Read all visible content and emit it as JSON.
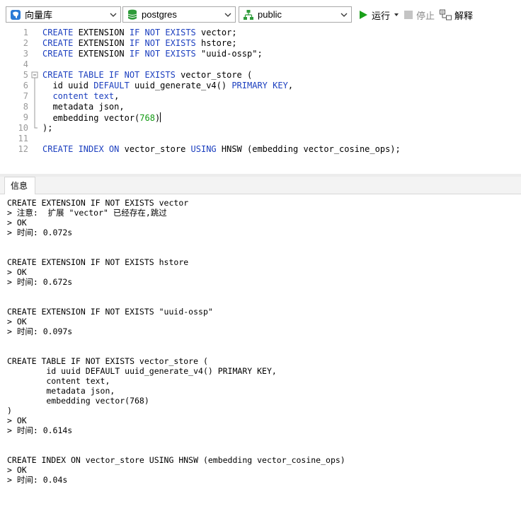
{
  "toolbar": {
    "connection": "向量库",
    "database": "postgres",
    "schema": "public",
    "run_label": "运行",
    "stop_label": "停止",
    "explain_label": "解释"
  },
  "editor": {
    "lines": [
      {
        "n": "1",
        "tokens": [
          {
            "t": "kw",
            "v": "CREATE"
          },
          {
            "t": "id",
            "v": " EXTENSION "
          },
          {
            "t": "kw",
            "v": "IF NOT EXISTS"
          },
          {
            "t": "id",
            "v": " vector;"
          }
        ]
      },
      {
        "n": "2",
        "tokens": [
          {
            "t": "kw",
            "v": "CREATE"
          },
          {
            "t": "id",
            "v": " EXTENSION "
          },
          {
            "t": "kw",
            "v": "IF NOT EXISTS"
          },
          {
            "t": "id",
            "v": " hstore;"
          }
        ]
      },
      {
        "n": "3",
        "tokens": [
          {
            "t": "kw",
            "v": "CREATE"
          },
          {
            "t": "id",
            "v": " EXTENSION "
          },
          {
            "t": "kw",
            "v": "IF NOT EXISTS"
          },
          {
            "t": "str",
            "v": " \"uuid-ossp\";"
          }
        ]
      },
      {
        "n": "4",
        "tokens": []
      },
      {
        "n": "5",
        "tokens": [
          {
            "t": "kw",
            "v": "CREATE TABLE IF NOT EXISTS"
          },
          {
            "t": "id",
            "v": " vector_store ("
          }
        ]
      },
      {
        "n": "6",
        "tokens": [
          {
            "t": "id",
            "v": "  id uuid "
          },
          {
            "t": "kw",
            "v": "DEFAULT"
          },
          {
            "t": "id",
            "v": " uuid_generate_v4() "
          },
          {
            "t": "kw",
            "v": "PRIMARY KEY"
          },
          {
            "t": "id",
            "v": ","
          }
        ]
      },
      {
        "n": "7",
        "tokens": [
          {
            "t": "id",
            "v": "  "
          },
          {
            "t": "kw",
            "v": "content text"
          },
          {
            "t": "id",
            "v": ","
          }
        ]
      },
      {
        "n": "8",
        "tokens": [
          {
            "t": "id",
            "v": "  metadata json,"
          }
        ]
      },
      {
        "n": "9",
        "tokens": [
          {
            "t": "id",
            "v": "  embedding vector("
          },
          {
            "t": "num",
            "v": "768"
          },
          {
            "t": "id",
            "v": ")"
          }
        ]
      },
      {
        "n": "10",
        "tokens": [
          {
            "t": "id",
            "v": ");"
          }
        ]
      },
      {
        "n": "11",
        "tokens": []
      },
      {
        "n": "12",
        "tokens": [
          {
            "t": "kw",
            "v": "CREATE INDEX ON"
          },
          {
            "t": "id",
            "v": " vector_store "
          },
          {
            "t": "kw",
            "v": "USING"
          },
          {
            "t": "id",
            "v": " HNSW (embedding vector_cosine_ops);"
          }
        ]
      }
    ]
  },
  "tabs": [
    {
      "label": "信息"
    }
  ],
  "output": {
    "lines": [
      "CREATE EXTENSION IF NOT EXISTS vector",
      "> 注意:  扩展 \"vector\" 已经存在,跳过",
      "> OK",
      "> 时间: 0.072s",
      "",
      "",
      "CREATE EXTENSION IF NOT EXISTS hstore",
      "> OK",
      "> 时间: 0.672s",
      "",
      "",
      "CREATE EXTENSION IF NOT EXISTS \"uuid-ossp\"",
      "> OK",
      "> 时间: 0.097s",
      "",
      "",
      "CREATE TABLE IF NOT EXISTS vector_store (",
      "        id uuid DEFAULT uuid_generate_v4() PRIMARY KEY,",
      "        content text,",
      "        metadata json,",
      "        embedding vector(768)",
      ")",
      "> OK",
      "> 时间: 0.614s",
      "",
      "",
      "CREATE INDEX ON vector_store USING HNSW (embedding vector_cosine_ops)",
      "> OK",
      "> 时间: 0.04s"
    ]
  },
  "colors": {
    "keyword": "#1c3fbf",
    "number": "#129a12",
    "run_green": "#1aa01a",
    "db_green": "#2e9b3a",
    "conn_blue": "#2b7ad6"
  }
}
